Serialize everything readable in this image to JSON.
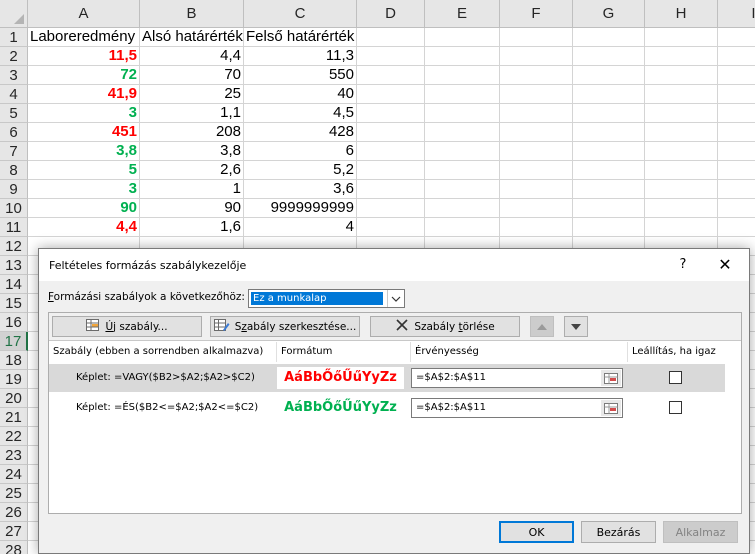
{
  "sheet": {
    "columns": [
      "A",
      "B",
      "C",
      "D",
      "E",
      "F",
      "G",
      "H",
      "I"
    ],
    "rows": [
      "1",
      "2",
      "3",
      "4",
      "5",
      "6",
      "7",
      "8",
      "9",
      "10",
      "11",
      "12",
      "13",
      "14",
      "15",
      "16",
      "17",
      "18",
      "19",
      "20",
      "21",
      "22",
      "23",
      "24",
      "25",
      "26",
      "27",
      "28"
    ],
    "selected_row": "17",
    "header_row": [
      "Laboreredmény",
      "Alsó határérték",
      "Felső határérték"
    ],
    "data_rows": [
      {
        "a": "11,5",
        "b": "4,4",
        "c": "11,3",
        "status": "out"
      },
      {
        "a": "72",
        "b": "70",
        "c": "550",
        "status": "in"
      },
      {
        "a": "41,9",
        "b": "25",
        "c": "40",
        "status": "out"
      },
      {
        "a": "3",
        "b": "1,1",
        "c": "4,5",
        "status": "in"
      },
      {
        "a": "451",
        "b": "208",
        "c": "428",
        "status": "out"
      },
      {
        "a": "3,8",
        "b": "3,8",
        "c": "6",
        "status": "in"
      },
      {
        "a": "5",
        "b": "2,6",
        "c": "5,2",
        "status": "in"
      },
      {
        "a": "3",
        "b": "1",
        "c": "3,6",
        "status": "in"
      },
      {
        "a": "90",
        "b": "90",
        "c": "9999999999",
        "status": "in"
      },
      {
        "a": "4,4",
        "b": "1,6",
        "c": "4",
        "status": "out"
      }
    ],
    "colors": {
      "out_of_range": "#ff0000",
      "in_range": "#00b050",
      "selection": "#217346"
    }
  },
  "dialog": {
    "title": "Feltételes formázás szabálykezelője",
    "help": "?",
    "close": "✕",
    "show_rules_label_accel": "F",
    "show_rules_label_rest": "ormázási szabályok a következőhöz:",
    "scope_value": "Ez a munkalap",
    "toolbar": {
      "new_rule_accel": "Ú",
      "new_rule_rest": "j szabály...",
      "edit_rule_pre": "S",
      "edit_rule_accel": "z",
      "edit_rule_rest": "abály szerkesztése...",
      "delete_rule_pre": "Szabály ",
      "delete_rule_accel": "t",
      "delete_rule_rest": "örlése"
    },
    "columns": {
      "rule": "Szabály (ebben a sorrendben alkalmazva)",
      "format": "Formátum",
      "applies_to": "Érvényesség",
      "stop_if_true": "Leállítás, ha igaz"
    },
    "rules": [
      {
        "description": "Képlet: =VAGY($B2>$A2;$A2>$C2)",
        "preview": "AáBbŐőŰűYyZz",
        "preview_color": "#ff0000",
        "applies_to": "=$A$2:$A$11",
        "stop_if_true": false,
        "selected": true
      },
      {
        "description": "Képlet: =ÉS($B2<=$A2;$A2<=$C2)",
        "preview": "AáBbŐőŰűYyZz",
        "preview_color": "#00b050",
        "applies_to": "=$A$2:$A$11",
        "stop_if_true": false,
        "selected": false
      }
    ],
    "buttons": {
      "ok": "OK",
      "close": "Bezárás",
      "apply": "Alkalmaz"
    }
  }
}
